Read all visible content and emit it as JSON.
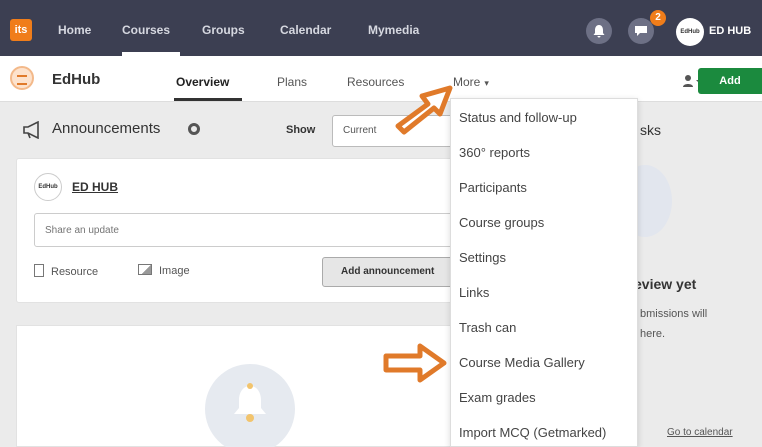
{
  "topnav": {
    "logo": "its",
    "links": [
      "Home",
      "Courses",
      "Groups",
      "Calendar",
      "Mymedia"
    ],
    "notification_count": "2",
    "avatar_text": "EdHub",
    "user_name": "ED HUB"
  },
  "course": {
    "title": "EdHub",
    "tabs": [
      "Overview",
      "Plans",
      "Resources",
      "More"
    ],
    "more_caret": "▾",
    "add_label": "Add"
  },
  "announcements": {
    "title": "Announcements",
    "show_label": "Show",
    "show_value": "Current",
    "author_avatar": "EdHub",
    "author_name": "ED HUB",
    "share_placeholder": "Share an update",
    "resource_label": "Resource",
    "image_label": "Image",
    "add_button": "Add announcement"
  },
  "tasks": {
    "title": "sks",
    "review_title": "eview yet",
    "review_text_line1": "bmissions will",
    "review_text_line2": "here.",
    "calendar_link": "Go to calendar"
  },
  "more_menu": {
    "items": [
      "Status and follow-up",
      "360° reports",
      "Participants",
      "Course groups",
      "Settings",
      "Links",
      "Trash can",
      "Course Media Gallery",
      "Exam grades",
      "Import MCQ (Getmarked)"
    ]
  },
  "colors": {
    "topnav_bg": "#3c3f52",
    "brand_orange": "#f07d1a",
    "add_green": "#1b8a3e",
    "arrow_orange": "#e07a2a"
  },
  "icons": [
    "logo-icon",
    "bell-icon",
    "chat-icon",
    "megaphone-icon",
    "gear-icon",
    "person-icon",
    "file-icon",
    "image-icon",
    "arrow-icon"
  ]
}
